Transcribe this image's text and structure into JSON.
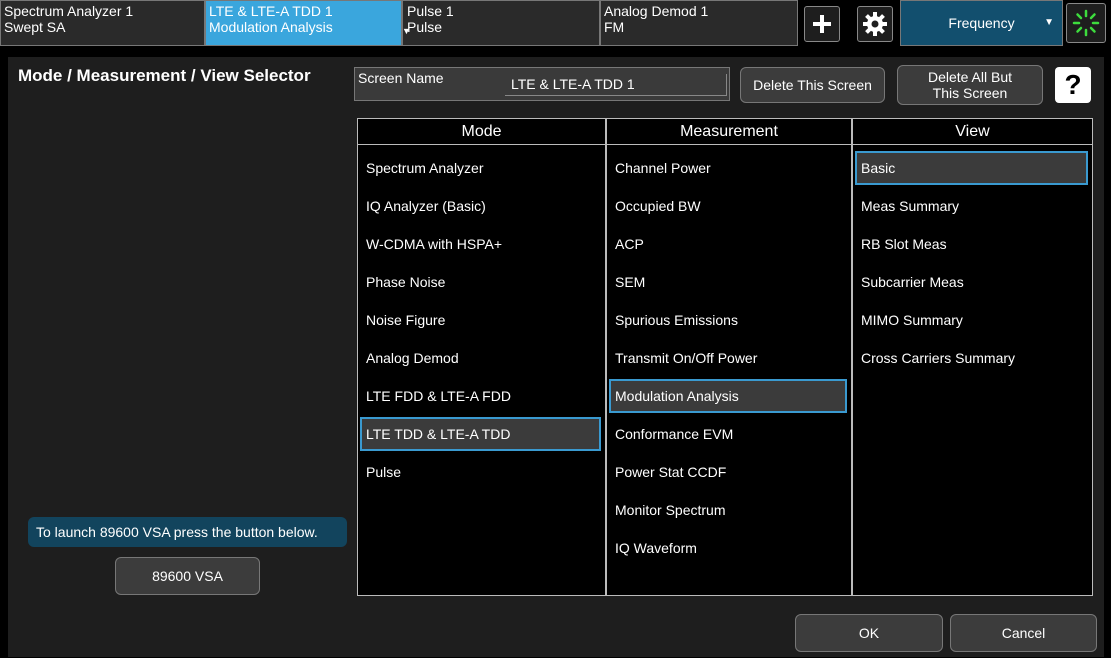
{
  "tabs": [
    {
      "line1": "Spectrum Analyzer 1",
      "line2": "Swept SA"
    },
    {
      "line1": "LTE & LTE-A TDD 1",
      "line2": "Modulation Analysis"
    },
    {
      "line1": "Pulse 1",
      "line2": "Pulse"
    },
    {
      "line1": "Analog Demod 1",
      "line2": "FM"
    }
  ],
  "toolbar": {
    "add_icon": "plus-icon",
    "settings_icon": "gear-icon",
    "frequency_label": "Frequency",
    "busy_icon": "spinner-icon"
  },
  "dialog": {
    "title": "Mode / Measurement / View Selector",
    "screen_name_label": "Screen Name",
    "screen_name_value": "LTE & LTE-A TDD 1",
    "delete_screen": "Delete This Screen",
    "delete_all_line1": "Delete All But",
    "delete_all_line2": "This Screen",
    "help": "?",
    "vsa_message": "To launch 89600 VSA press the button below.",
    "vsa_button": "89600 VSA",
    "ok": "OK",
    "cancel": "Cancel"
  },
  "columns": {
    "mode_header": "Mode",
    "measurement_header": "Measurement",
    "view_header": "View",
    "modes": [
      "Spectrum Analyzer",
      "IQ Analyzer (Basic)",
      "W-CDMA with HSPA+",
      "Phase Noise",
      "Noise Figure",
      "Analog Demod",
      "LTE FDD & LTE-A FDD",
      "LTE TDD & LTE-A TDD",
      "Pulse"
    ],
    "measurements": [
      "Channel Power",
      "Occupied BW",
      "ACP",
      "SEM",
      "Spurious Emissions",
      "Transmit On/Off Power",
      "Modulation Analysis",
      "Conformance EVM",
      "Power Stat CCDF",
      "Monitor Spectrum",
      "IQ Waveform"
    ],
    "views": [
      "Basic",
      "Meas Summary",
      "RB Slot Meas",
      "Subcarrier Meas",
      "MIMO Summary",
      "Cross Carriers Summary"
    ]
  },
  "colors": {
    "active_tab": "#3aa6dd",
    "selection_border": "#3a9ad0",
    "frequency_bg": "#124f6e"
  }
}
